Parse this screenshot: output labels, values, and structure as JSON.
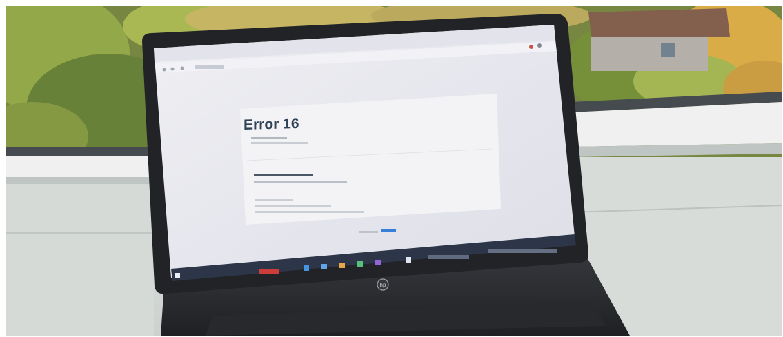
{
  "photo": {
    "description_free": true,
    "device_logo": "hp",
    "colors": {
      "sky_foliage": "#8a9a3a",
      "wall": "#d7dcd9",
      "laptop_bezel": "#17181c",
      "screen": "#e7e8ef",
      "card": "#f1f1f4",
      "accent": "#2b78d8"
    }
  },
  "screen": {
    "error_title": "Error 16"
  },
  "icons": [
    "back-icon",
    "forward-icon",
    "refresh-icon",
    "start-icon",
    "search-icon",
    "taskbar-app-icon",
    "hp-logo-icon"
  ]
}
